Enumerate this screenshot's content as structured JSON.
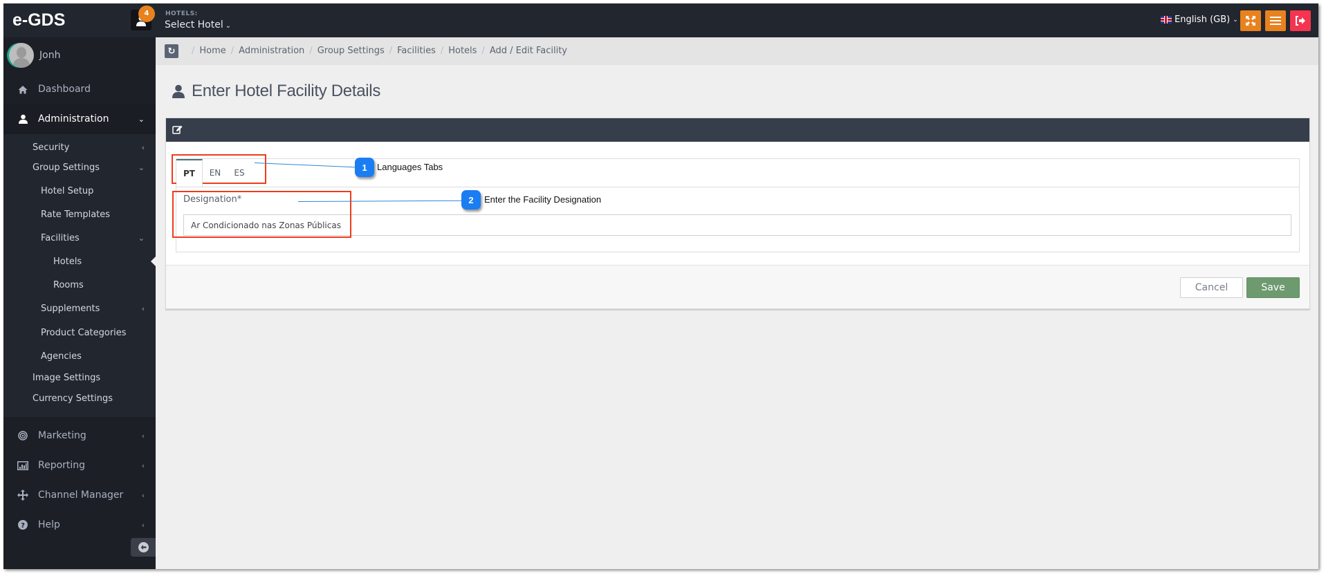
{
  "app": {
    "logo": "e-GDS",
    "notification_count": "4",
    "hotels_label": "HOTELS:",
    "hotel_select": "Select Hotel",
    "language": "English (GB)"
  },
  "icons": {
    "user": "user-icon",
    "fullscreen": "fullscreen-icon",
    "menu": "hamburger-icon",
    "logout": "logout-icon",
    "refresh": "refresh-icon",
    "edit": "edit-icon",
    "collapse": "arrow-left-circle-icon"
  },
  "colors": {
    "topbar": "#22262e",
    "sidebar": "#1c1f26",
    "accent_orange": "#e8821e",
    "logout_red": "#f5344f",
    "panel_header": "#363d4b",
    "save_green": "#6e9a6f",
    "annotation_red": "#ee3b1b",
    "annotation_blue": "#1a7df2"
  },
  "sidebar": {
    "user_name": "Jonh",
    "items": [
      {
        "label": "Dashboard",
        "icon": "home-icon"
      },
      {
        "label": "Administration",
        "icon": "user-icon",
        "expanded": true
      },
      {
        "label": "Marketing",
        "icon": "bullseye-icon"
      },
      {
        "label": "Reporting",
        "icon": "bar-chart-icon"
      },
      {
        "label": "Channel Manager",
        "icon": "move-arrows-icon"
      },
      {
        "label": "Help",
        "icon": "question-circle-icon"
      }
    ],
    "admin_sub": {
      "security": "Security",
      "group_settings": "Group Settings",
      "hotel_setup": "Hotel Setup",
      "rate_templates": "Rate Templates",
      "facilities": "Facilities",
      "hotels": "Hotels",
      "rooms": "Rooms",
      "supplements": "Supplements",
      "product_categories": "Product Categories",
      "agencies": "Agencies",
      "image_settings": "Image Settings",
      "currency_settings": "Currency Settings"
    }
  },
  "breadcrumb": [
    "Home",
    "Administration",
    "Group Settings",
    "Facilities",
    "Hotels",
    "Add / Edit Facility"
  ],
  "page": {
    "title": "Enter Hotel Facility Details",
    "tabs": [
      "PT",
      "EN",
      "ES"
    ],
    "active_tab": "PT",
    "designation_label": "Designation*",
    "designation_value": "Ar Condicionado nas Zonas Públicas",
    "cancel_label": "Cancel",
    "save_label": "Save"
  },
  "annotations": [
    {
      "number": "1",
      "text": "Languages Tabs"
    },
    {
      "number": "2",
      "text": "Enter the Facility Designation"
    }
  ]
}
